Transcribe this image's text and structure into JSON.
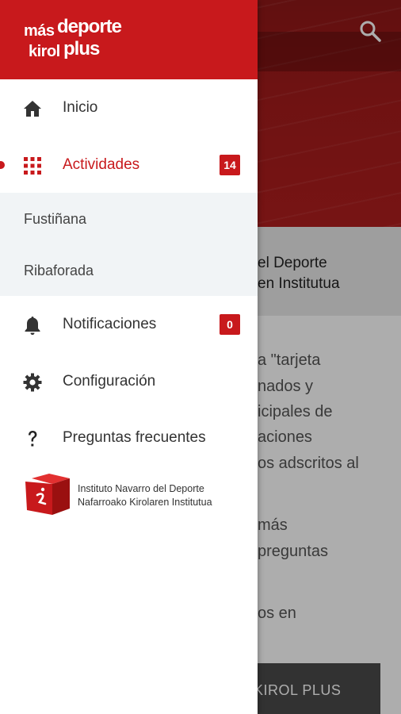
{
  "colors": {
    "brand_red": "#c8191c",
    "scrim": "#00000052"
  },
  "background": {
    "header_line1": "el Deporte",
    "header_line2": "en Institutua",
    "body_lines": [
      "a \"tarjeta",
      "nados y",
      "icipales de",
      "aciones",
      "os adscritos al",
      "más",
      "preguntas",
      "os en"
    ],
    "button_label": "KIROL PLUS",
    "search_icon": "search-icon"
  },
  "drawer": {
    "logo": {
      "line1a": "más",
      "line1b": "deporte",
      "line2a": "kirol",
      "line2b": "plus"
    },
    "items": [
      {
        "label": "Inicio",
        "icon": "home-icon"
      },
      {
        "label": "Actividades",
        "icon": "grid-icon",
        "badge": "14",
        "active": true
      },
      {
        "label": "Notificaciones",
        "icon": "bell-icon",
        "badge": "0"
      },
      {
        "label": "Configuración",
        "icon": "gear-icon"
      },
      {
        "label": "Preguntas frecuentes",
        "icon": "question-icon"
      }
    ],
    "sub_items": [
      "Fustiñana",
      "Ribaforada"
    ],
    "institute": {
      "line1": "Instituto Navarro del Deporte",
      "line2": "Nafarroako Kirolaren Institutua"
    }
  }
}
